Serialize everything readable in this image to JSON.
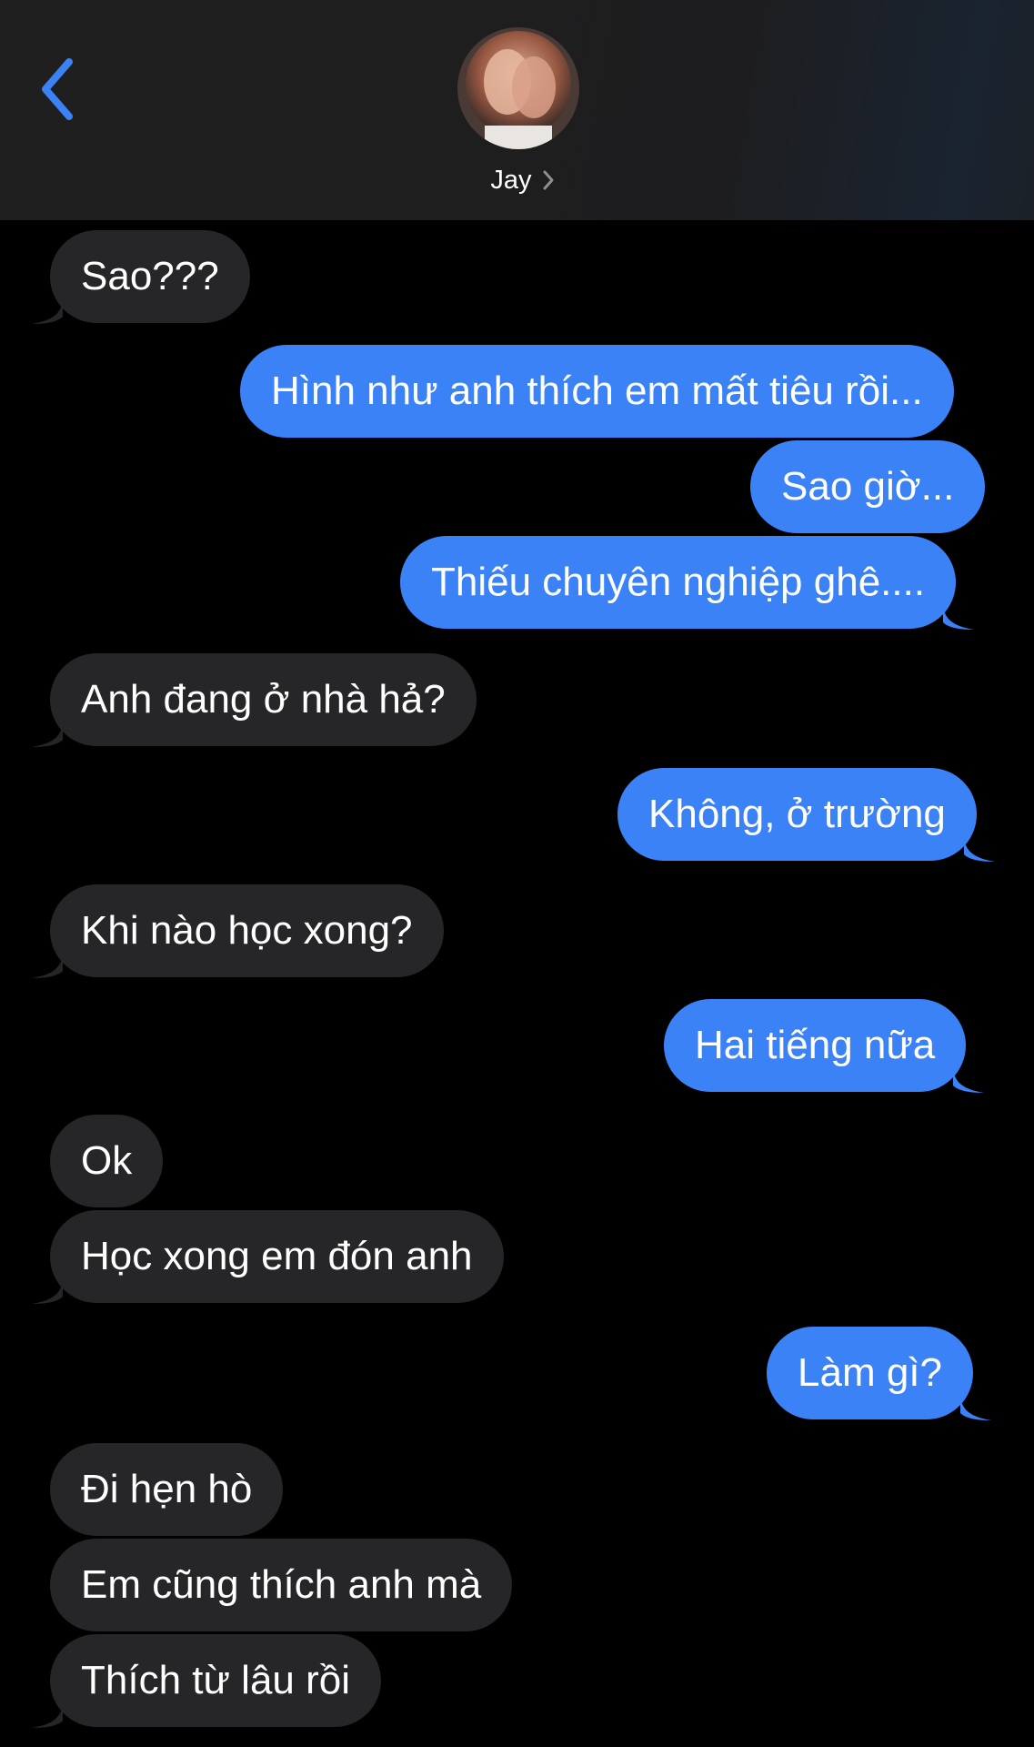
{
  "header": {
    "contact_name": "Jay",
    "back_icon": "chevron-left-icon",
    "disclosure_icon": "chevron-right-icon"
  },
  "colors": {
    "accent": "#3b82f6",
    "sent_bubble": "#3b82f6",
    "received_bubble": "#262628",
    "background": "#000000",
    "header_background": "#1f1f1f"
  },
  "messages": [
    {
      "from": "them",
      "text": "Sao???"
    },
    {
      "from": "me",
      "text": "Hình như anh thích em mất tiêu rồi..."
    },
    {
      "from": "me",
      "text": "Sao giờ..."
    },
    {
      "from": "me",
      "text": "Thiếu chuyên nghiệp ghê...."
    },
    {
      "from": "them",
      "text": "Anh đang ở nhà hả?"
    },
    {
      "from": "me",
      "text": "Không, ở trường"
    },
    {
      "from": "them",
      "text": "Khi nào học xong?"
    },
    {
      "from": "me",
      "text": "Hai tiếng nữa"
    },
    {
      "from": "them",
      "text": "Ok"
    },
    {
      "from": "them",
      "text": "Học xong em đón anh"
    },
    {
      "from": "me",
      "text": "Làm gì?"
    },
    {
      "from": "them",
      "text": "Đi hẹn hò"
    },
    {
      "from": "them",
      "text": "Em cũng thích anh mà"
    },
    {
      "from": "them",
      "text": "Thích từ lâu rồi"
    }
  ]
}
